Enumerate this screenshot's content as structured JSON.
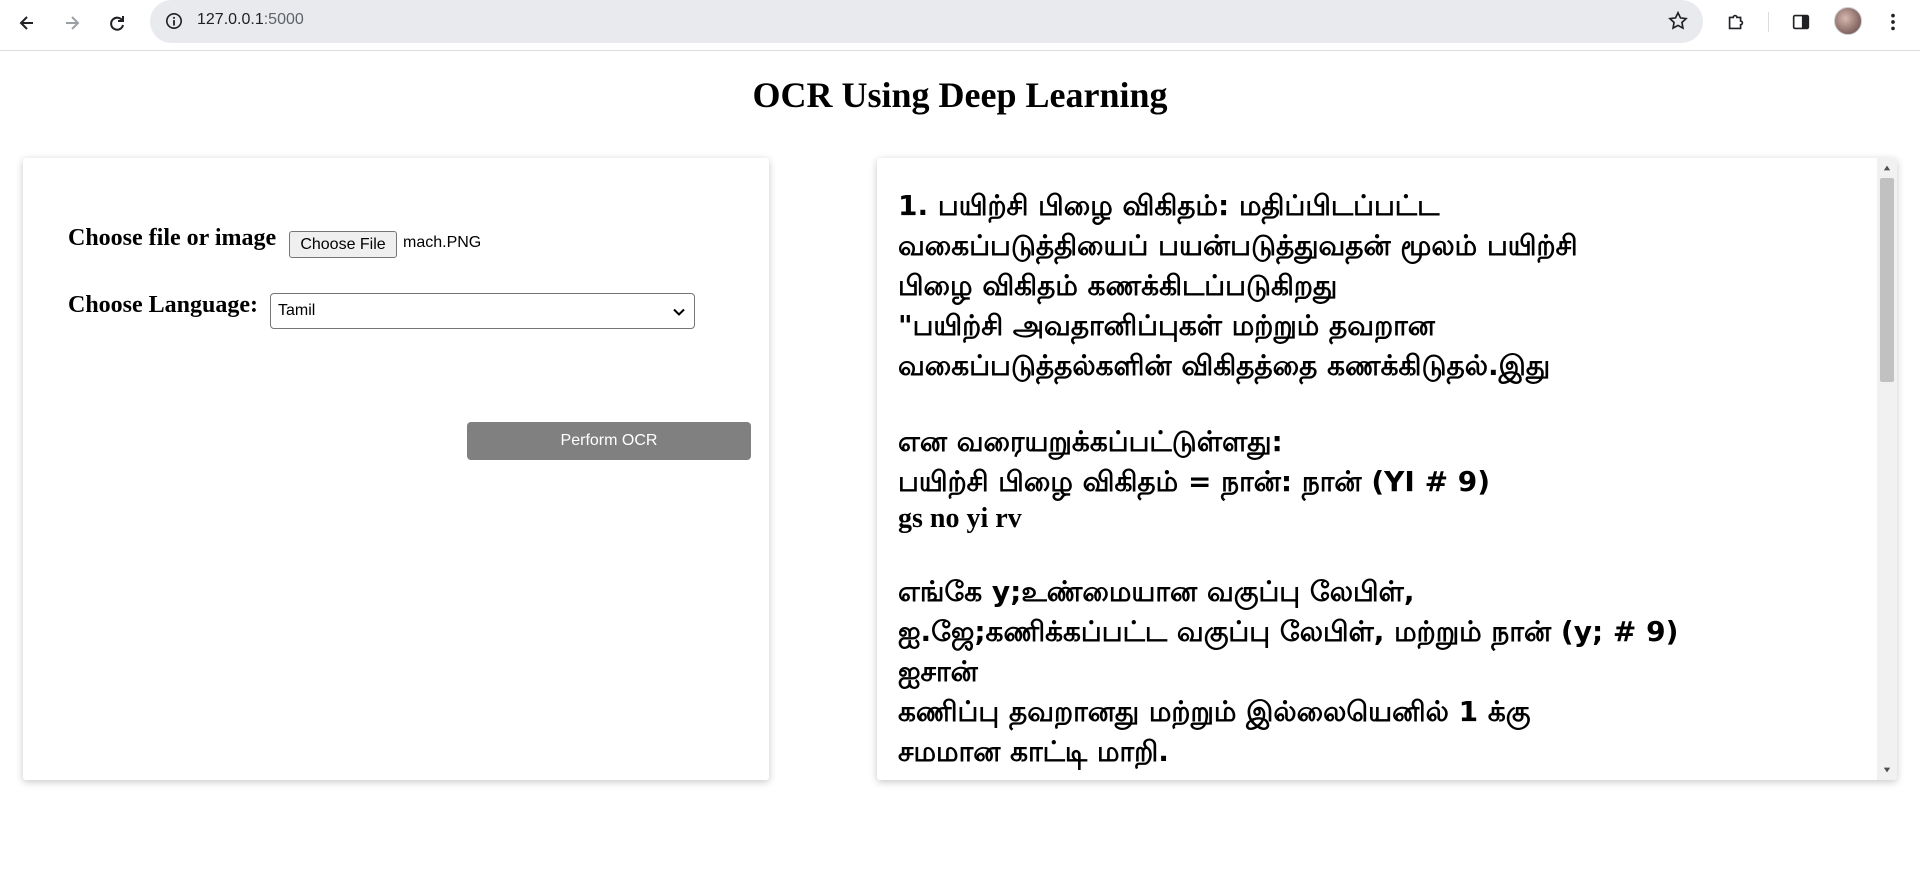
{
  "browser": {
    "url_host": "127.0.0.1",
    "url_port": ":5000"
  },
  "page": {
    "title": "OCR Using Deep Learning"
  },
  "form": {
    "file_label": "Choose file or image",
    "file_button": "Choose File",
    "file_name": "mach.PNG",
    "language_label": "Choose Language:",
    "language_selected": "Tamil",
    "submit_label": "Perform OCR"
  },
  "output": {
    "lines": [
      "1. பயிற்சி பிழை விகிதம்: மதிப்பிடப்பட்ட",
      "வகைப்படுத்தியைப் பயன்படுத்துவதன் மூலம் பயிற்சி",
      "பிழை விகிதம் கணக்கிடப்படுகிறது",
      "\"பயிற்சி அவதானிப்புகள் மற்றும் தவறான",
      "வகைப்படுத்தல்களின் விகிதத்தை கணக்கிடுதல்.இது",
      "",
      "என வரையறுக்கப்பட்டுள்ளது:",
      "பயிற்சி பிழை விகிதம் = நான்: நான் (YI # 9)",
      "gs no yi rv",
      "",
      "எங்கே y;உண்மையான வகுப்பு லேபிள்,",
      "ஐ.ஜே;கணிக்கப்பட்ட வகுப்பு லேபிள், மற்றும் நான் (y; # 9)",
      "ஐசான்",
      "கணிப்பு தவறானது மற்றும் இல்லையெனில் 1 க்கு",
      "சமமான காட்டி மாறி."
    ]
  },
  "icons": {
    "back": "back-arrow-icon",
    "forward": "forward-arrow-icon",
    "reload": "reload-icon",
    "info": "info-icon",
    "star": "star-icon",
    "extensions": "puzzle-icon",
    "side_panel": "side-panel-icon",
    "menu": "kebab-menu-icon"
  }
}
